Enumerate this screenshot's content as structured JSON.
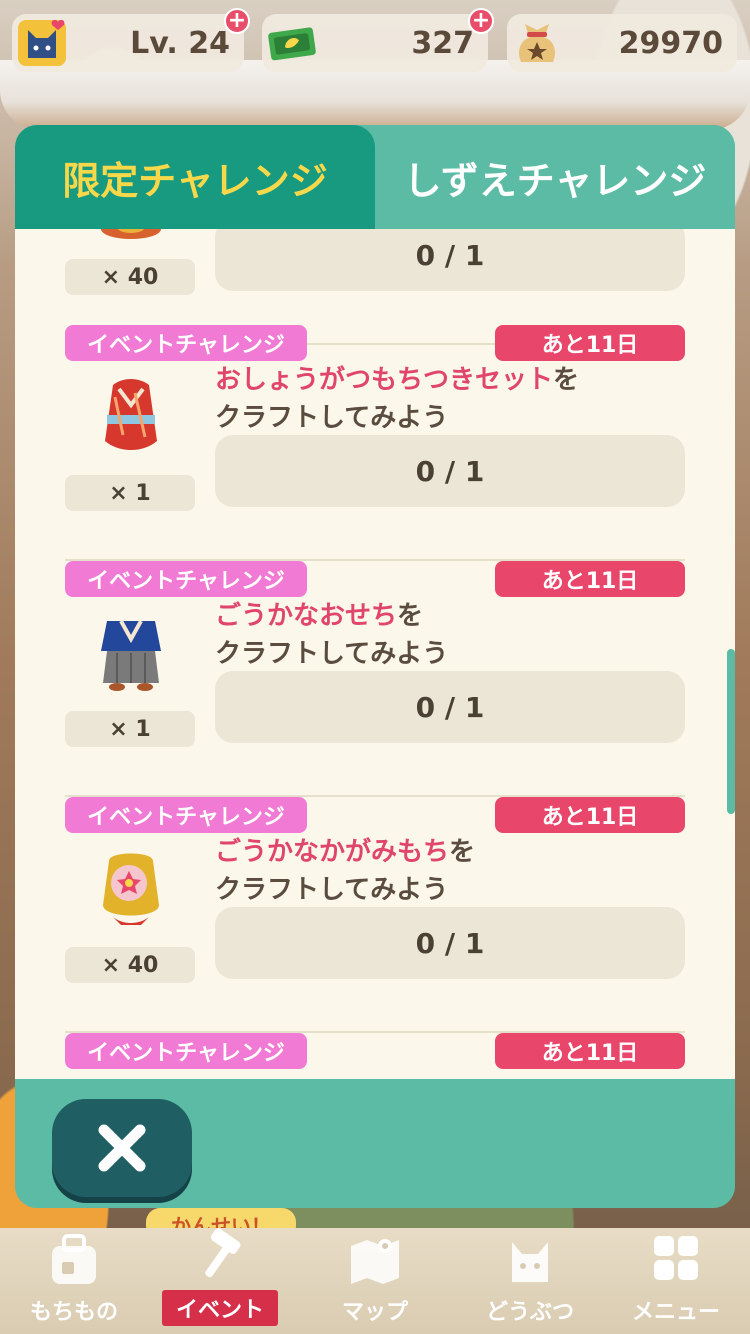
{
  "status": {
    "level_text": "Lv. 24",
    "leaf_tickets": "327",
    "bells": "29970"
  },
  "tabs": [
    {
      "label": "限定チャレンジ",
      "active": true
    },
    {
      "label": "しずえチャレンジ",
      "active": false
    }
  ],
  "challenges": [
    {
      "tag": "",
      "remaining": "",
      "highlight": "",
      "suffix": "",
      "line2": "",
      "progress": "0 / 1",
      "reward_qty": "× 40",
      "icon": "partial-item-icon"
    },
    {
      "tag": "イベントチャレンジ",
      "remaining": "あと11日",
      "highlight": "おしょうがつもちつきセット",
      "suffix": "を",
      "line2": "クラフトしてみよう",
      "progress": "0 / 1",
      "reward_qty": "× 1",
      "icon": "red-kimono-icon"
    },
    {
      "tag": "イベントチャレンジ",
      "remaining": "あと11日",
      "highlight": "ごうかなおせち",
      "suffix": "を",
      "line2": "クラフトしてみよう",
      "progress": "0 / 1",
      "reward_qty": "× 1",
      "icon": "blue-hakama-icon"
    },
    {
      "tag": "イベントチャレンジ",
      "remaining": "あと11日",
      "highlight": "ごうかなかがみもち",
      "suffix": "を",
      "line2": "クラフトしてみよう",
      "progress": "0 / 1",
      "reward_qty": "× 40",
      "icon": "gold-lucky-bag-icon"
    },
    {
      "tag": "イベントチャレンジ",
      "remaining": "あと11日"
    }
  ],
  "close_icon": "close-icon",
  "complete_badge": "かんせい！",
  "nav": [
    {
      "label": "もちもの",
      "icon": "bag-icon"
    },
    {
      "label": "イベント",
      "icon": "hammer-icon"
    },
    {
      "label": "マップ",
      "icon": "map-icon"
    },
    {
      "label": "どうぶつ",
      "icon": "cat-icon"
    },
    {
      "label": "メニュー",
      "icon": "menu-grid-icon"
    }
  ],
  "colors": {
    "teal": "#5bbba4",
    "teal_dark": "#189a80",
    "tab_active_text": "#f6d84a",
    "event_tag": "#f17ad4",
    "remaining_tag": "#e8466a",
    "highlight": "#e0466a",
    "panel": "#fbf7ea"
  }
}
